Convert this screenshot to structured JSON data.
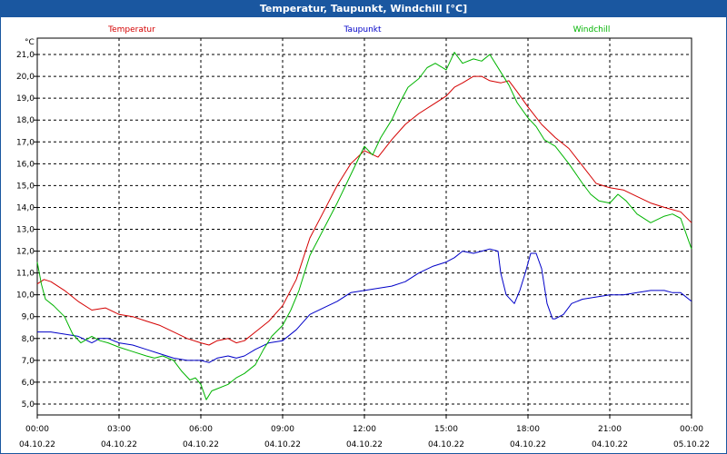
{
  "window": {
    "title": "Temperatur, Taupunkt, Windchill [°C]"
  },
  "chart_data": {
    "type": "line",
    "title": "Temperatur, Taupunkt, Windchill [°C]",
    "ylabel": "°C",
    "ylim": [
      4.5,
      21.75
    ],
    "xlim": [
      0,
      24
    ],
    "grid": true,
    "legend_position": "top",
    "y_ticks": [
      "5,0",
      "6,0",
      "7,0",
      "8,0",
      "9,0",
      "10,0",
      "11,0",
      "12,0",
      "13,0",
      "14,0",
      "15,0",
      "16,0",
      "17,0",
      "18,0",
      "19,0",
      "20,0",
      "21,0"
    ],
    "x_ticks": [
      {
        "time": "00:00",
        "date": "04.10.22",
        "hour": 0
      },
      {
        "time": "03:00",
        "date": "04.10.22",
        "hour": 3
      },
      {
        "time": "06:00",
        "date": "04.10.22",
        "hour": 6
      },
      {
        "time": "09:00",
        "date": "04.10.22",
        "hour": 9
      },
      {
        "time": "12:00",
        "date": "04.10.22",
        "hour": 12
      },
      {
        "time": "15:00",
        "date": "04.10.22",
        "hour": 15
      },
      {
        "time": "18:00",
        "date": "04.10.22",
        "hour": 18
      },
      {
        "time": "21:00",
        "date": "04.10.22",
        "hour": 21
      },
      {
        "time": "00:00",
        "date": "05.10.22",
        "hour": 24
      }
    ],
    "series": [
      {
        "name": "Temperatur",
        "color": "#d40000",
        "x": [
          0,
          0.25,
          0.5,
          1,
          1.5,
          2,
          2.5,
          3,
          3.5,
          4,
          4.5,
          5,
          5.5,
          6,
          6.3,
          6.6,
          7,
          7.3,
          7.6,
          8,
          8.5,
          9,
          9.5,
          10,
          10.5,
          11,
          11.5,
          12,
          12.5,
          13,
          13.5,
          14,
          14.5,
          15,
          15.3,
          15.6,
          16,
          16.3,
          16.6,
          17,
          17.3,
          17.6,
          18,
          18.5,
          19,
          19.5,
          20,
          20.5,
          21,
          21.5,
          22,
          22.5,
          23,
          23.3,
          23.6,
          24
        ],
        "y": [
          10.5,
          10.7,
          10.6,
          10.2,
          9.7,
          9.3,
          9.4,
          9.1,
          9.0,
          8.8,
          8.6,
          8.3,
          8.0,
          7.8,
          7.7,
          7.9,
          8.0,
          7.8,
          7.9,
          8.3,
          8.8,
          9.5,
          10.7,
          12.6,
          13.8,
          15.0,
          16.0,
          16.6,
          16.3,
          17.1,
          17.8,
          18.3,
          18.7,
          19.1,
          19.5,
          19.7,
          20.0,
          20.0,
          19.8,
          19.7,
          19.8,
          19.3,
          18.6,
          17.8,
          17.2,
          16.7,
          15.9,
          15.1,
          14.9,
          14.8,
          14.5,
          14.2,
          14.0,
          13.9,
          13.8,
          13.3
        ]
      },
      {
        "name": "Taupunkt",
        "color": "#0000c8",
        "x": [
          0,
          0.5,
          1,
          1.5,
          2,
          2.3,
          2.6,
          3,
          3.5,
          4,
          4.5,
          5,
          5.5,
          6,
          6.3,
          6.6,
          7,
          7.3,
          7.6,
          8,
          8.5,
          9,
          9.5,
          10,
          10.5,
          11,
          11.5,
          12,
          12.5,
          13,
          13.5,
          14,
          14.5,
          15,
          15.3,
          15.6,
          16,
          16.3,
          16.6,
          16.9,
          17,
          17.2,
          17.5,
          17.7,
          17.9,
          18.1,
          18.3,
          18.5,
          18.7,
          18.9,
          19,
          19.3,
          19.6,
          20,
          20.5,
          21,
          21.5,
          22,
          22.5,
          23,
          23.3,
          23.6,
          24
        ],
        "y": [
          8.3,
          8.3,
          8.2,
          8.1,
          7.8,
          8.0,
          8.0,
          7.8,
          7.7,
          7.5,
          7.3,
          7.1,
          7.0,
          7.0,
          6.9,
          7.1,
          7.2,
          7.1,
          7.2,
          7.5,
          7.8,
          7.9,
          8.4,
          9.1,
          9.4,
          9.7,
          10.1,
          10.2,
          10.3,
          10.4,
          10.6,
          11.0,
          11.3,
          11.5,
          11.7,
          12.0,
          11.9,
          12.0,
          12.1,
          12.0,
          11.0,
          10.0,
          9.6,
          10.2,
          11.0,
          11.9,
          11.9,
          11.2,
          9.6,
          8.9,
          8.9,
          9.1,
          9.6,
          9.8,
          9.9,
          10.0,
          10.0,
          10.1,
          10.2,
          10.2,
          10.1,
          10.1,
          9.7
        ]
      },
      {
        "name": "Windchill",
        "color": "#00b400",
        "x": [
          0,
          0.15,
          0.3,
          0.6,
          1,
          1.3,
          1.6,
          2,
          2.3,
          2.6,
          3,
          3.5,
          4,
          4.3,
          4.6,
          5,
          5.3,
          5.6,
          5.8,
          6,
          6.2,
          6.4,
          6.6,
          7,
          7.3,
          7.6,
          8,
          8.3,
          8.6,
          9,
          9.3,
          9.6,
          10,
          10.5,
          11,
          11.5,
          12,
          12.3,
          12.6,
          13,
          13.3,
          13.6,
          14,
          14.3,
          14.6,
          15,
          15.3,
          15.6,
          16,
          16.3,
          16.6,
          17,
          17.3,
          17.6,
          18,
          18.3,
          18.6,
          19,
          19.5,
          20,
          20.3,
          20.6,
          21,
          21.3,
          21.6,
          22,
          22.5,
          23,
          23.3,
          23.6,
          24
        ],
        "y": [
          11.5,
          10.5,
          9.8,
          9.5,
          9.0,
          8.2,
          7.8,
          8.1,
          7.9,
          7.8,
          7.6,
          7.4,
          7.2,
          7.1,
          7.2,
          7.0,
          6.5,
          6.1,
          6.2,
          5.9,
          5.2,
          5.6,
          5.7,
          5.9,
          6.2,
          6.4,
          6.8,
          7.5,
          8.1,
          8.6,
          9.3,
          10.2,
          11.8,
          13.0,
          14.2,
          15.5,
          16.8,
          16.4,
          17.2,
          18.0,
          18.8,
          19.5,
          19.9,
          20.4,
          20.6,
          20.3,
          21.1,
          20.6,
          20.8,
          20.7,
          21.0,
          20.2,
          19.6,
          18.8,
          18.1,
          17.7,
          17.1,
          16.8,
          16.0,
          15.1,
          14.6,
          14.3,
          14.2,
          14.6,
          14.3,
          13.7,
          13.3,
          13.6,
          13.7,
          13.5,
          12.1
        ]
      }
    ]
  }
}
